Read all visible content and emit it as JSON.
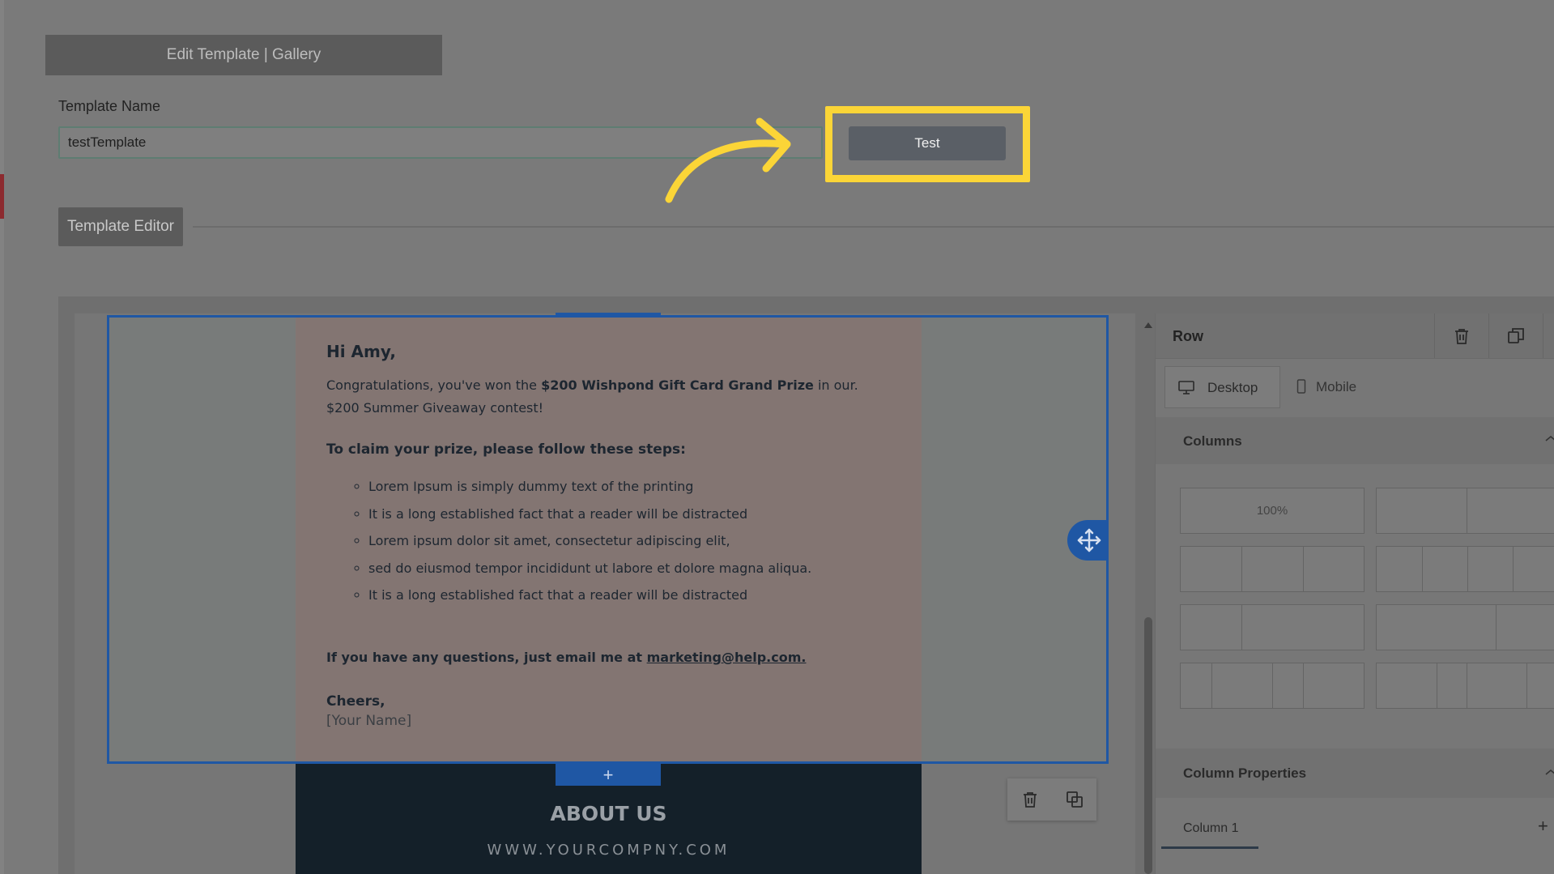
{
  "page_tab": {
    "label": "Edit Template | Gallery"
  },
  "template_name": {
    "label": "Template Name",
    "value": "testTemplate"
  },
  "test_button": {
    "label": "Test"
  },
  "editor_tab": {
    "label": "Template Editor"
  },
  "email": {
    "greeting": "Hi Amy,",
    "intro_before": "Congratulations, you've won the ",
    "intro_bold": "$200 Wishpond Gift Card Grand Prize",
    "intro_after": " in our. $200 Summer Giveaway contest!",
    "steps_heading": "To claim your prize, please follow these steps:",
    "steps": [
      "Lorem Ipsum is simply dummy text of the printing",
      "It is a long established fact that a reader will be distracted",
      "Lorem ipsum dolor sit amet, consectetur adipiscing elit,",
      "sed do eiusmod tempor incididunt ut labore et dolore magna aliqua.",
      "It is a long established fact that a reader will be distracted"
    ],
    "question_text": "If you have any questions, just email me at ",
    "question_email": "marketing@help.com.",
    "cheers": "Cheers,",
    "signature": "[Your Name]"
  },
  "add_row": {
    "label": "+"
  },
  "about": {
    "title": "ABOUT US",
    "url": "WWW.YOURCOMPNY.COM"
  },
  "side_panel": {
    "title": "Row",
    "tabs": [
      {
        "label": "Desktop",
        "icon": "monitor-icon"
      },
      {
        "label": "Mobile",
        "icon": "phone-icon"
      }
    ],
    "columns_section": "Columns",
    "column_option_full": "100%",
    "column_properties": "Column Properties",
    "column_tab": "Column 1",
    "add_column": "+"
  },
  "colors": {
    "highlight": "#fbd537",
    "selection": "#1f57a4",
    "test_button": "#5a5f66"
  }
}
